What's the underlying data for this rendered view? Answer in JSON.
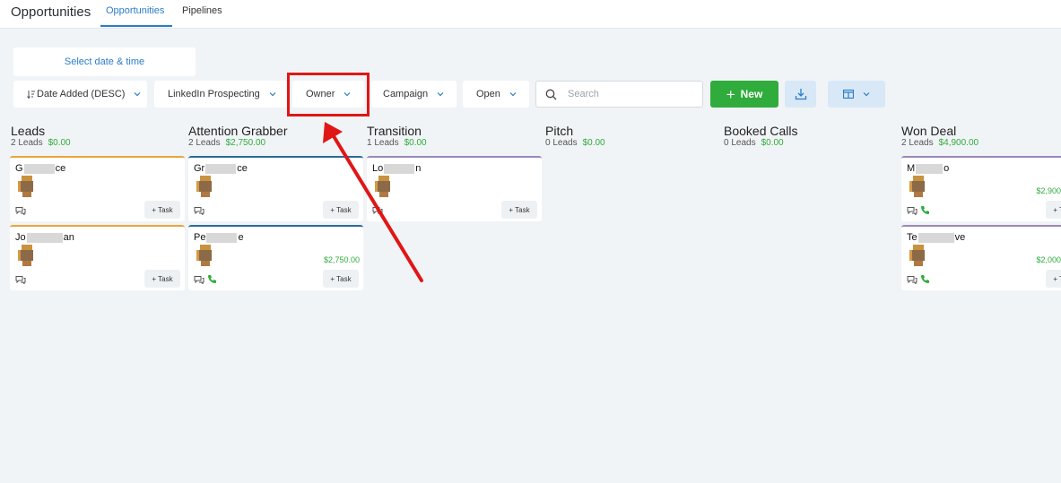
{
  "header": {
    "app_title": "Opportunities",
    "tabs": [
      {
        "label": "Opportunities",
        "active": true
      },
      {
        "label": "Pipelines",
        "active": false
      }
    ]
  },
  "toolbar": {
    "date_picker_label": "Select date & time",
    "filters": [
      {
        "label": "Date Added (DESC)",
        "icon": "sort-icon"
      },
      {
        "label": "LinkedIn Prospecting"
      },
      {
        "label": "Owner",
        "highlighted": true
      },
      {
        "label": "Campaign"
      },
      {
        "label": "Open"
      }
    ],
    "search_placeholder": "Search",
    "new_button_label": "New",
    "new_button_color": "#2fac3b",
    "highlight_color": "#e01616"
  },
  "columns": [
    {
      "name": "Leads",
      "leads": "2 Leads",
      "amount": "$0.00"
    },
    {
      "name": "Attention Grabber",
      "leads": "2 Leads",
      "amount": "$2,750.00"
    },
    {
      "name": "Transition",
      "leads": "1 Leads",
      "amount": "$0.00"
    },
    {
      "name": "Pitch",
      "leads": "0 Leads",
      "amount": "$0.00"
    },
    {
      "name": "Booked Calls",
      "leads": "0 Leads",
      "amount": "$0.00"
    },
    {
      "name": "Won Deal",
      "leads": "2 Leads",
      "amount": "$4,900.00"
    }
  ],
  "cards": [
    {
      "name_start": "G",
      "name_end": "ce",
      "amount": "",
      "phone": false,
      "task_label": "+ Task"
    },
    {
      "name_start": "Jo",
      "name_end": "an",
      "amount": "",
      "phone": false,
      "task_label": "+ Task"
    },
    {
      "name_start": "Gr",
      "name_end": "ce",
      "amount": "",
      "phone": false,
      "task_label": "+ Task"
    },
    {
      "name_start": "Pe",
      "name_end": "e",
      "amount": "$2,750.00",
      "phone": true,
      "task_label": "+ Task"
    },
    {
      "name_start": "Lo",
      "name_end": "n",
      "amount": "",
      "phone": false,
      "task_label": "+ Task"
    },
    {
      "name_start": "M",
      "name_end": "o",
      "amount": "$2,900",
      "phone": true,
      "task_label": "+ Task"
    },
    {
      "name_start": "Te",
      "name_end": "ve",
      "amount": "$2,000",
      "phone": true,
      "task_label": "+ Task"
    }
  ]
}
